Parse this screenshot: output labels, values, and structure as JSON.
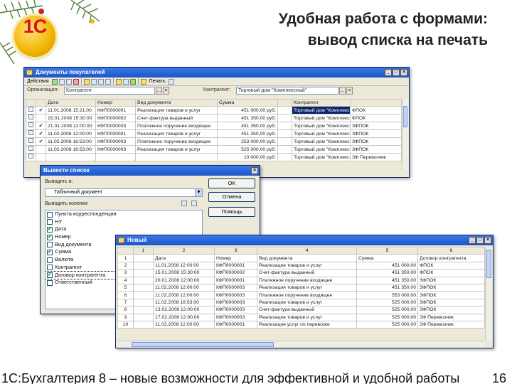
{
  "slide": {
    "title_line1": "Удобная работа с формами:",
    "title_line2": "вывод списка на печать",
    "logo_text": "1С",
    "footer": "1С:Бухгалтерия 8 – новые возможности для эффективной и удобной работы",
    "page_number": "16"
  },
  "colors": {
    "titlebar": "#1c55c9",
    "selection": "#0a246a",
    "logo": "#f2b400",
    "logo_text": "#d7121a"
  },
  "docs_window": {
    "title": "Документы покупателей",
    "toolbar": {
      "actions_label": "Действия",
      "print_label": "Печать",
      "help_label": ""
    },
    "filter": {
      "org_label": "Организация:",
      "org_value": "Контрагент",
      "contract_label": "Контрагент:",
      "contract_value": "Торговый дом \"Комплексный\""
    },
    "columns": [
      "",
      "",
      "Дата",
      "Номер",
      "Вид документа",
      "Сумма",
      "",
      "Контрагент",
      ""
    ],
    "rows": [
      {
        "date": "11.01.2008 15:21:00",
        "number": "КФП0000001",
        "kind": "Реализация товаров и услуг",
        "sum": "451 000,00 руб.",
        "partner": "Торговый дом \"Комплексный\"",
        "org": "ФПОК",
        "checked": true,
        "selected": true
      },
      {
        "date": "15.01.2008 15:30:00",
        "number": "КФП0000002",
        "kind": "Счет-фактура выданный",
        "sum": "451 350,00 руб.",
        "partner": "Торговый дом \"Комплексный\"",
        "org": "ФПОК",
        "checked": false,
        "selected": false
      },
      {
        "date": "21.01.2008 12:00:00",
        "number": "КФП0000003",
        "kind": "Платежное поручение входящее",
        "sum": "451 350,00 руб.",
        "partner": "Торговый дом \"Комплексный\"",
        "org": "ЗФПОК",
        "checked": true,
        "selected": false
      },
      {
        "date": "11.02.2008 12:00:00",
        "number": "КФП0000001",
        "kind": "Реализация товаров и услуг",
        "sum": "451 350,00 руб.",
        "partner": "Торговый дом \"Комплексный\"",
        "org": "ЗФПОК",
        "checked": true,
        "selected": false
      },
      {
        "date": "11.02.2008 16:53:00",
        "number": "КФП0000003",
        "kind": "Платежное поручение входящее",
        "sum": "253 000,00 руб.",
        "partner": "Торговый дом \"Комплексный\"",
        "org": "ЗФПОК",
        "checked": true,
        "selected": false
      },
      {
        "date": "11.02.2008 16:53:00",
        "number": "КФП0000003",
        "kind": "Реализация товаров и услуг",
        "sum": "525 000,00 руб.",
        "partner": "Торговый дом \"Комплексный\"",
        "org": "ЗФПОК",
        "checked": false,
        "selected": false
      },
      {
        "date": "",
        "number": "",
        "kind": "",
        "sum": "10 000,00 руб.",
        "partner": "Торговый дом \"Комплексный\"",
        "org": "ЗФ Перевозчик",
        "checked": false,
        "selected": false
      }
    ]
  },
  "dialog": {
    "title": "Вывести список",
    "output_label": "Выводить в:",
    "output_value": "Табличный документ",
    "columns_label": "Выводить колонки:",
    "ok_label": "OK",
    "cancel_label": "Отмена",
    "help_label": "Помощь",
    "columns": [
      {
        "label": "Пункта корреспонденции",
        "checked": false,
        "selected": false
      },
      {
        "label": "НУ",
        "checked": false,
        "selected": false
      },
      {
        "label": "Дата",
        "checked": true,
        "selected": false
      },
      {
        "label": "Номер",
        "checked": true,
        "selected": false
      },
      {
        "label": "Вид документа",
        "checked": false,
        "selected": false
      },
      {
        "label": "Сумма",
        "checked": true,
        "selected": false
      },
      {
        "label": "Валюта",
        "checked": false,
        "selected": false
      },
      {
        "label": "Контрагент",
        "checked": false,
        "selected": false
      },
      {
        "label": "Договор контрагента",
        "checked": true,
        "selected": true
      },
      {
        "label": "Ответственный",
        "checked": false,
        "selected": false
      }
    ]
  },
  "result_window": {
    "title": "Новый",
    "col_numbers": [
      "",
      "1",
      "2",
      "3",
      "4",
      "5",
      "6"
    ],
    "header": [
      "1",
      "Дата",
      "Номер",
      "Вид документа",
      "Сумма",
      "Договор контрагента"
    ],
    "rows": [
      {
        "n": "2",
        "date": "11.01.2008 12:00:00",
        "number": "КФП0000001",
        "kind": "Реализация товаров и услуг",
        "sum": "451 000,00",
        "contract": "ФПОК"
      },
      {
        "n": "3",
        "date": "15.01.2008 15:30:00",
        "number": "КФП0000002",
        "kind": "Счет-фактура выданный",
        "sum": "451 350,00",
        "contract": "ФПОК"
      },
      {
        "n": "4",
        "date": "20.01.2008 12:00:00",
        "number": "КФП0000001",
        "kind": "Платежное поручение входящее",
        "sum": "451 350,00",
        "contract": "ЗФПОК"
      },
      {
        "n": "5",
        "date": "11.02.2008 12:00:00",
        "number": "КФП0000003",
        "kind": "Реализация товаров и услуг",
        "sum": "451 350,00",
        "contract": "ЗФПОК"
      },
      {
        "n": "6",
        "date": "11.02.2008 12:00:00",
        "number": "КФП0000003",
        "kind": "Платежное поручение входящее",
        "sum": "553 000,00",
        "contract": "ЗФПОК"
      },
      {
        "n": "7",
        "date": "11.02.2008 16:53:00",
        "number": "КФП0000003",
        "kind": "Реализация товаров и услуг",
        "sum": "525 000,00",
        "contract": "ЗФПОК"
      },
      {
        "n": "8",
        "date": "13.02.2008 12:00:00",
        "number": "КФП0000003",
        "kind": "Счет-фактура выданный",
        "sum": "525 000,00",
        "contract": "ЗФПОК"
      },
      {
        "n": "9",
        "date": "17.02.2008 12:00:00",
        "number": "КФП0000003",
        "kind": "Реализация товаров и услуг",
        "sum": "525 000,00",
        "contract": "ЗФ Перевозчик"
      },
      {
        "n": "10",
        "date": "11.02.2008 12:00:00",
        "number": "КФП0000001",
        "kind": "Реализация услуг по перевозке",
        "sum": "525 000,00",
        "contract": "ЗФ Перевозчик"
      }
    ]
  }
}
